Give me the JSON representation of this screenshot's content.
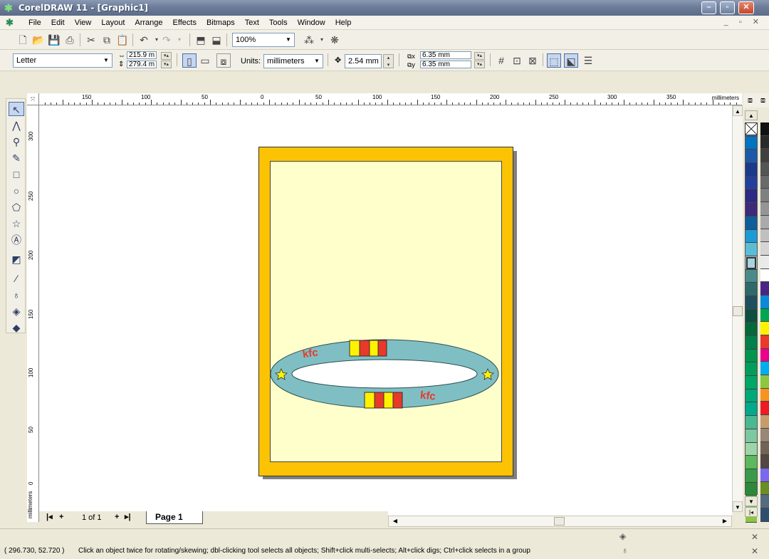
{
  "window": {
    "title": "CorelDRAW 11 - [Graphic1]",
    "min_glyph": "–",
    "max_glyph": "▫",
    "close_glyph": "✕"
  },
  "menu": {
    "items": [
      "File",
      "Edit",
      "View",
      "Layout",
      "Arrange",
      "Effects",
      "Bitmaps",
      "Text",
      "Tools",
      "Window",
      "Help"
    ],
    "mdi_controls": "_ ▫ ✕"
  },
  "standard_toolbar": {
    "zoom": "100%"
  },
  "property_bar": {
    "paper_size": "Letter",
    "width": "215.9 m",
    "height": "279.4 m",
    "units_label": "Units:",
    "units": "millimeters",
    "nudge": "2.54 mm",
    "dup_x": "6.35 mm",
    "dup_y": "6.35 mm"
  },
  "rulers": {
    "unit": "millimeters",
    "top_ticks": [
      "150",
      "100",
      "50",
      "0",
      "50",
      "100",
      "150",
      "200",
      "250",
      "300",
      "350"
    ],
    "left_ticks": [
      "300",
      "250",
      "200",
      "150",
      "100",
      "50",
      "0"
    ]
  },
  "toolbox": {
    "tools": [
      "pick-tool",
      "shape-tool",
      "zoom-tool",
      "freehand-tool",
      "rectangle-tool",
      "ellipse-tool",
      "polygon-tool",
      "basic-shapes-tool",
      "text-tool",
      "interactive-tool",
      "eyedropper-tool",
      "outline-tool",
      "fill-tool",
      "interactive-fill-tool"
    ]
  },
  "artwork": {
    "ring_text_top": "kfc",
    "ring_text_bottom": "kfc",
    "colors": {
      "page_border": "#fcc304",
      "page_inner": "#ffffcc",
      "ring": "#7fbfc4",
      "logo": "#e8392a",
      "stripe_yellow": "#fff200",
      "stripe_red": "#e8392a"
    }
  },
  "page_nav": {
    "counter": "1 of 1",
    "tab": "Page 1"
  },
  "palette": {
    "colors": [
      "#4a6aa8",
      "#0074c0",
      "#1c5aa8",
      "#1a3a8c",
      "#223f9e",
      "#2c2a84",
      "#3d2a7a",
      "#0e5e9c",
      "#1d9ad6",
      "#5cbcd6",
      "#a8d4e0",
      "#4a8a8a",
      "#2f6a6a",
      "#1f4f5f",
      "#0e4e3e",
      "#006a3a",
      "#00804a",
      "#00944f",
      "#009e5a",
      "#00a765",
      "#00a878",
      "#00aa8a",
      "#4ab890",
      "#7cc8a0",
      "#9cd6a8",
      "#5cb85c",
      "#3a9a4a",
      "#2a8a3a",
      "#6abf45",
      "#8ec63f"
    ],
    "colors2": [
      "#111111",
      "#2a2a2a",
      "#404040",
      "#555555",
      "#6a6a6a",
      "#808080",
      "#959595",
      "#aaaaaa",
      "#c0c0c0",
      "#d5d5d5",
      "#eaeaea",
      "#ffffff",
      "#4b2585",
      "#0a8ad8",
      "#00a651",
      "#fff200",
      "#e8392a",
      "#ec008c",
      "#00aeef",
      "#8dc63f",
      "#f7941d",
      "#ed1c24",
      "#c69c6d",
      "#998675",
      "#736357",
      "#534741",
      "#7b68ee",
      "#6b8e23",
      "#556b7f",
      "#2f4f6f"
    ]
  },
  "status": {
    "coords": "( 296.730, 52.720 )",
    "message": "Click an object twice for rotating/skewing; dbl-clicking tool selects all objects; Shift+click multi-selects; Alt+click digs; Ctrl+click selects in a group"
  }
}
